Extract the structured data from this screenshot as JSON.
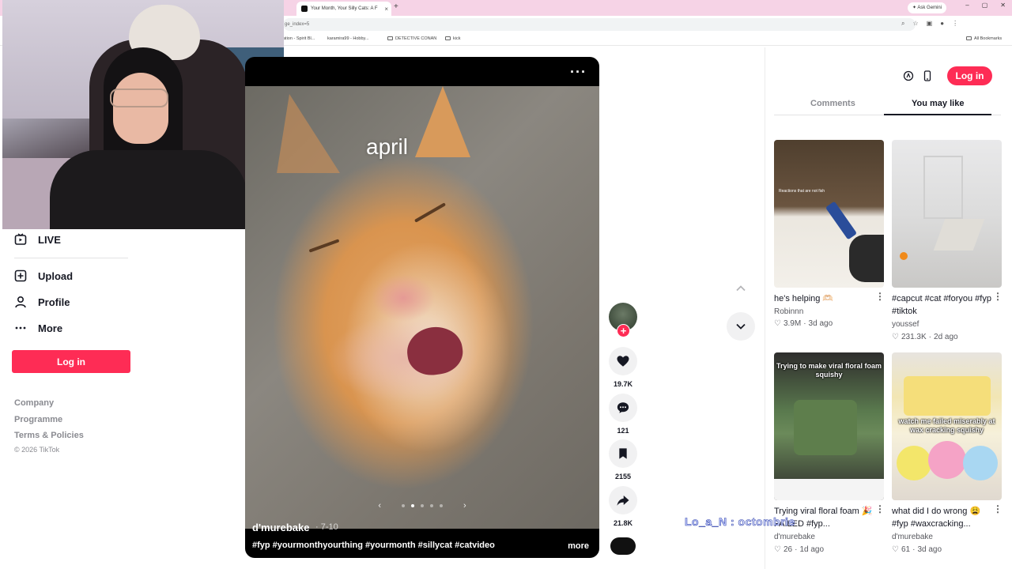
{
  "browser": {
    "tab_title": "Your Month, Your Silly Cats: A F",
    "tab_close": "×",
    "new_tab": "+",
    "url_fragment": "ge_index=5",
    "ask_gemini": "Ask Gemini",
    "window_controls": [
      "–",
      "▢",
      "✕"
    ],
    "bookmarks": [
      "ation - Spirit Bl...",
      "karamira99 - Hobby...",
      "DETECTIVE CONAN",
      "kick"
    ],
    "all_bookmarks": "All Bookmarks"
  },
  "sidebar": {
    "items": [
      {
        "label": "LIVE",
        "icon": "live-icon"
      },
      {
        "label": "Upload",
        "icon": "upload-icon"
      },
      {
        "label": "Profile",
        "icon": "profile-icon"
      },
      {
        "label": "More",
        "icon": "more-icon"
      }
    ],
    "login_label": "Log in",
    "footer_links": [
      "Company",
      "Programme",
      "Terms & Policies"
    ],
    "copyright": "© 2026 TikTok"
  },
  "video": {
    "overlay_text": "april",
    "author": "d'murebake",
    "date": "· 7-10",
    "hashtags": "#fyp #yourmonthyourthing #yourmonth #sillycat #catvideo",
    "more_label": "more",
    "carousel_prev": "‹",
    "carousel_next": "›",
    "carousel_active_index": 1,
    "carousel_count": 5
  },
  "actions": {
    "likes": "19.7K",
    "comments": "121",
    "saves": "2155",
    "shares": "21.8K"
  },
  "right_panel": {
    "login_label": "Log in",
    "tabs": [
      {
        "label": "Comments",
        "active": false
      },
      {
        "label": "You may like",
        "active": true
      }
    ],
    "cards": [
      {
        "title": "he's helping 🫶🏻",
        "author": "Robinnn",
        "likes": "3.9M",
        "age": "3d ago",
        "thumb_text": "Reactions that are not fish"
      },
      {
        "title": "#capcut #cat #foryou #fyp #tiktok",
        "author": "youssef",
        "likes": "231.3K",
        "age": "2d ago",
        "thumb_text": ""
      },
      {
        "title": "Trying viral floral foam 🎉 FAILED #fyp...",
        "author": "d'murebake",
        "likes": "26",
        "age": "1d ago",
        "thumb_text": "Trying to make viral floral foam squishy"
      },
      {
        "title": "what did I do wrong 😩 #fyp #waxcracking...",
        "author": "d'murebake",
        "likes": "61",
        "age": "3d ago",
        "thumb_text": "watch me failed miserably at wax cracking squishy"
      }
    ]
  },
  "stream_overlay": {
    "name": "Lo_a_N",
    "separator": " : ",
    "text": "octombrie"
  },
  "colors": {
    "brand_accent": "#fe2c55",
    "tabbar_pink": "#f6d3e6"
  }
}
